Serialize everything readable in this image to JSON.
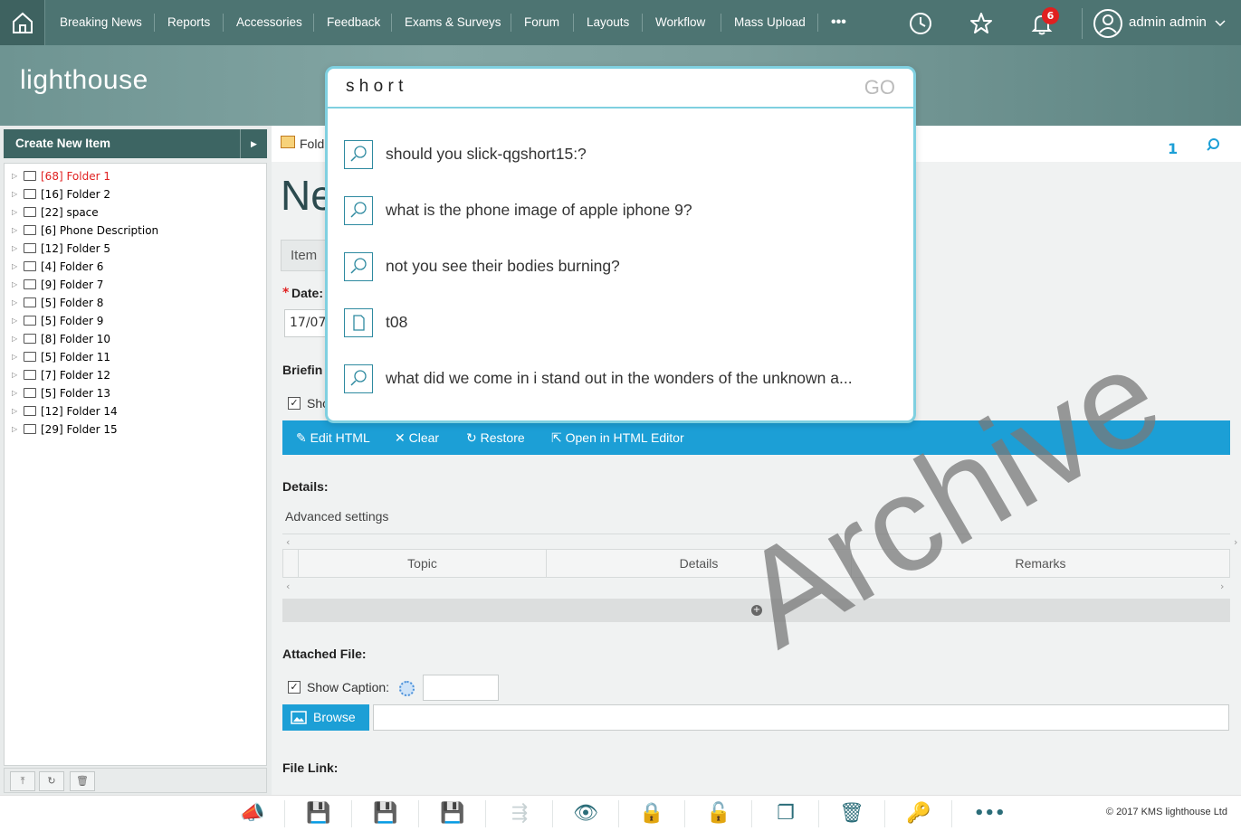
{
  "nav": {
    "items": [
      "Breaking News",
      "Reports",
      "Accessories",
      "Feedback",
      "Exams & Surveys",
      "Forum",
      "Layouts",
      "Workflow",
      "Mass Upload"
    ],
    "more": "•••",
    "notification_count": "6",
    "user": "admin admin"
  },
  "logo": "lighthouse",
  "sidebar": {
    "create_label": "Create New Item",
    "folders": [
      {
        "count": "[68]",
        "name": "Folder 1",
        "highlight": true
      },
      {
        "count": "[16]",
        "name": "Folder 2"
      },
      {
        "count": "[22]",
        "name": "space"
      },
      {
        "count": "[6]",
        "name": "Phone Description"
      },
      {
        "count": "[12]",
        "name": "Folder 5"
      },
      {
        "count": "[4]",
        "name": "Folder 6"
      },
      {
        "count": "[9]",
        "name": "Folder 7"
      },
      {
        "count": "[5]",
        "name": "Folder 8"
      },
      {
        "count": "[5]",
        "name": "Folder 9"
      },
      {
        "count": "[8]",
        "name": "Folder 10"
      },
      {
        "count": "[5]",
        "name": "Folder 11"
      },
      {
        "count": "[7]",
        "name": "Folder 12"
      },
      {
        "count": "[5]",
        "name": "Folder 13"
      },
      {
        "count": "[12]",
        "name": "Folder 14"
      },
      {
        "count": "[29]",
        "name": "Folder 15"
      }
    ]
  },
  "main": {
    "breadcrumb": "Fold",
    "page_count": "1",
    "title_partial": "Ne",
    "tab": "Item",
    "date_label": "Date:",
    "date_value": "17/07",
    "briefing_label": "Briefin",
    "show_partial": "Sho",
    "toolbar": {
      "edit": "Edit HTML",
      "clear": "Clear",
      "restore": "Restore",
      "open": "Open in HTML Editor"
    },
    "details_label": "Details:",
    "advanced": "Advanced settings",
    "grid_headers": [
      "Topic",
      "Details",
      "Remarks"
    ],
    "attached_label": "Attached File:",
    "show_caption": "Show Caption:",
    "browse": "Browse",
    "file_link": "File Link:"
  },
  "search_popup": {
    "query": "s h o r t ",
    "go": "GO",
    "suggestions": [
      {
        "text": "should you slick-qgshort15:?",
        "type": "search"
      },
      {
        "text": "what is the phone image of apple iphone 9?",
        "type": "search"
      },
      {
        "text": "not you see their bodies burning?",
        "type": "search"
      },
      {
        "text": "t08",
        "type": "document"
      },
      {
        "text": "what did we come in i stand out in the wonders of the unknown a...",
        "type": "search"
      }
    ]
  },
  "watermark": "Archive",
  "footer": {
    "copyright": "© 2017 KMS lighthouse Ltd"
  },
  "colors": {
    "topbar": "#4d7472",
    "accent": "#1c9fd6",
    "sidebar_header": "#3d6563",
    "popup_border": "#7fd0e0",
    "badge": "#e02020"
  }
}
